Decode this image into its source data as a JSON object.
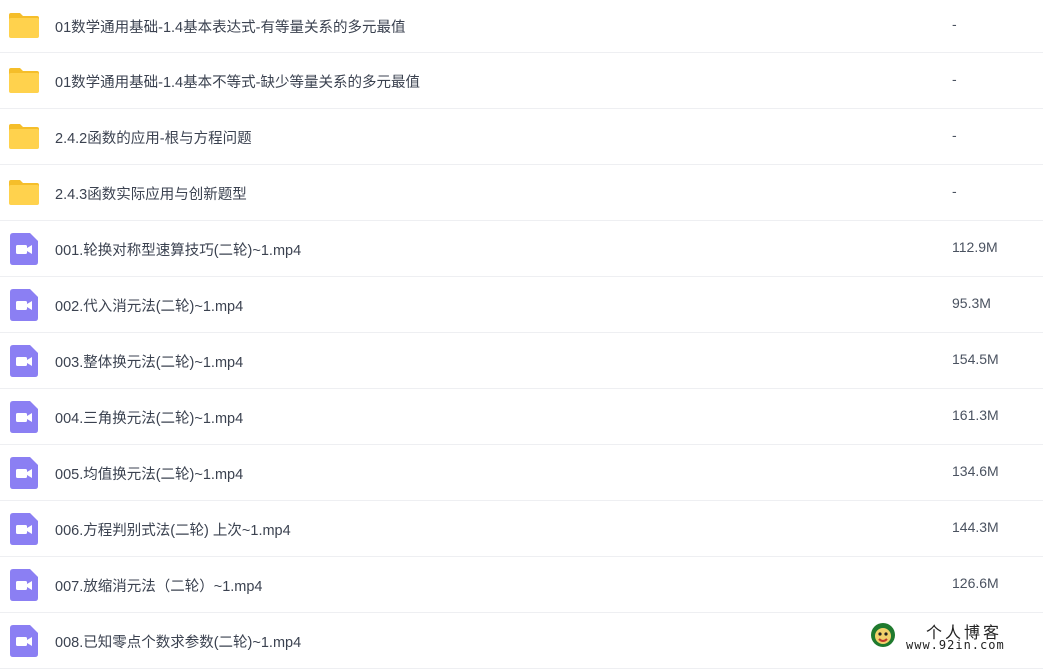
{
  "files": [
    {
      "type": "folder",
      "icon": "folder-icon",
      "name": "01数学通用基础-1.4基本表达式-有等量关系的多元最值",
      "size": "-"
    },
    {
      "type": "folder",
      "icon": "folder-icon",
      "name": "01数学通用基础-1.4基本不等式-缺少等量关系的多元最值",
      "size": "-"
    },
    {
      "type": "folder",
      "icon": "folder-icon",
      "name": "2.4.2函数的应用-根与方程问题",
      "size": "-"
    },
    {
      "type": "folder",
      "icon": "folder-icon",
      "name": "2.4.3函数实际应用与创新题型",
      "size": "-"
    },
    {
      "type": "video",
      "icon": "video-file-icon",
      "name": "001.轮换对称型速算技巧(二轮)~1.mp4",
      "size": "112.9M"
    },
    {
      "type": "video",
      "icon": "video-file-icon",
      "name": "002.代入消元法(二轮)~1.mp4",
      "size": "95.3M"
    },
    {
      "type": "video",
      "icon": "video-file-icon",
      "name": "003.整体换元法(二轮)~1.mp4",
      "size": "154.5M"
    },
    {
      "type": "video",
      "icon": "video-file-icon",
      "name": "004.三角换元法(二轮)~1.mp4",
      "size": "161.3M"
    },
    {
      "type": "video",
      "icon": "video-file-icon",
      "name": "005.均值换元法(二轮)~1.mp4",
      "size": "134.6M"
    },
    {
      "type": "video",
      "icon": "video-file-icon",
      "name": "006.方程判别式法(二轮) 上次~1.mp4",
      "size": "144.3M"
    },
    {
      "type": "video",
      "icon": "video-file-icon",
      "name": "007.放缩消元法（二轮）~1.mp4",
      "size": "126.6M"
    },
    {
      "type": "video",
      "icon": "video-file-icon",
      "name": "008.已知零点个数求参数(二轮)~1.mp4",
      "size": ""
    }
  ],
  "watermark": {
    "title": "个人博客",
    "url": "www.92in.com"
  },
  "colors": {
    "folder": "#ffd24d",
    "folder_tab": "#f5be2a",
    "video": "#8b7ff3",
    "divider": "#eeeff2"
  }
}
